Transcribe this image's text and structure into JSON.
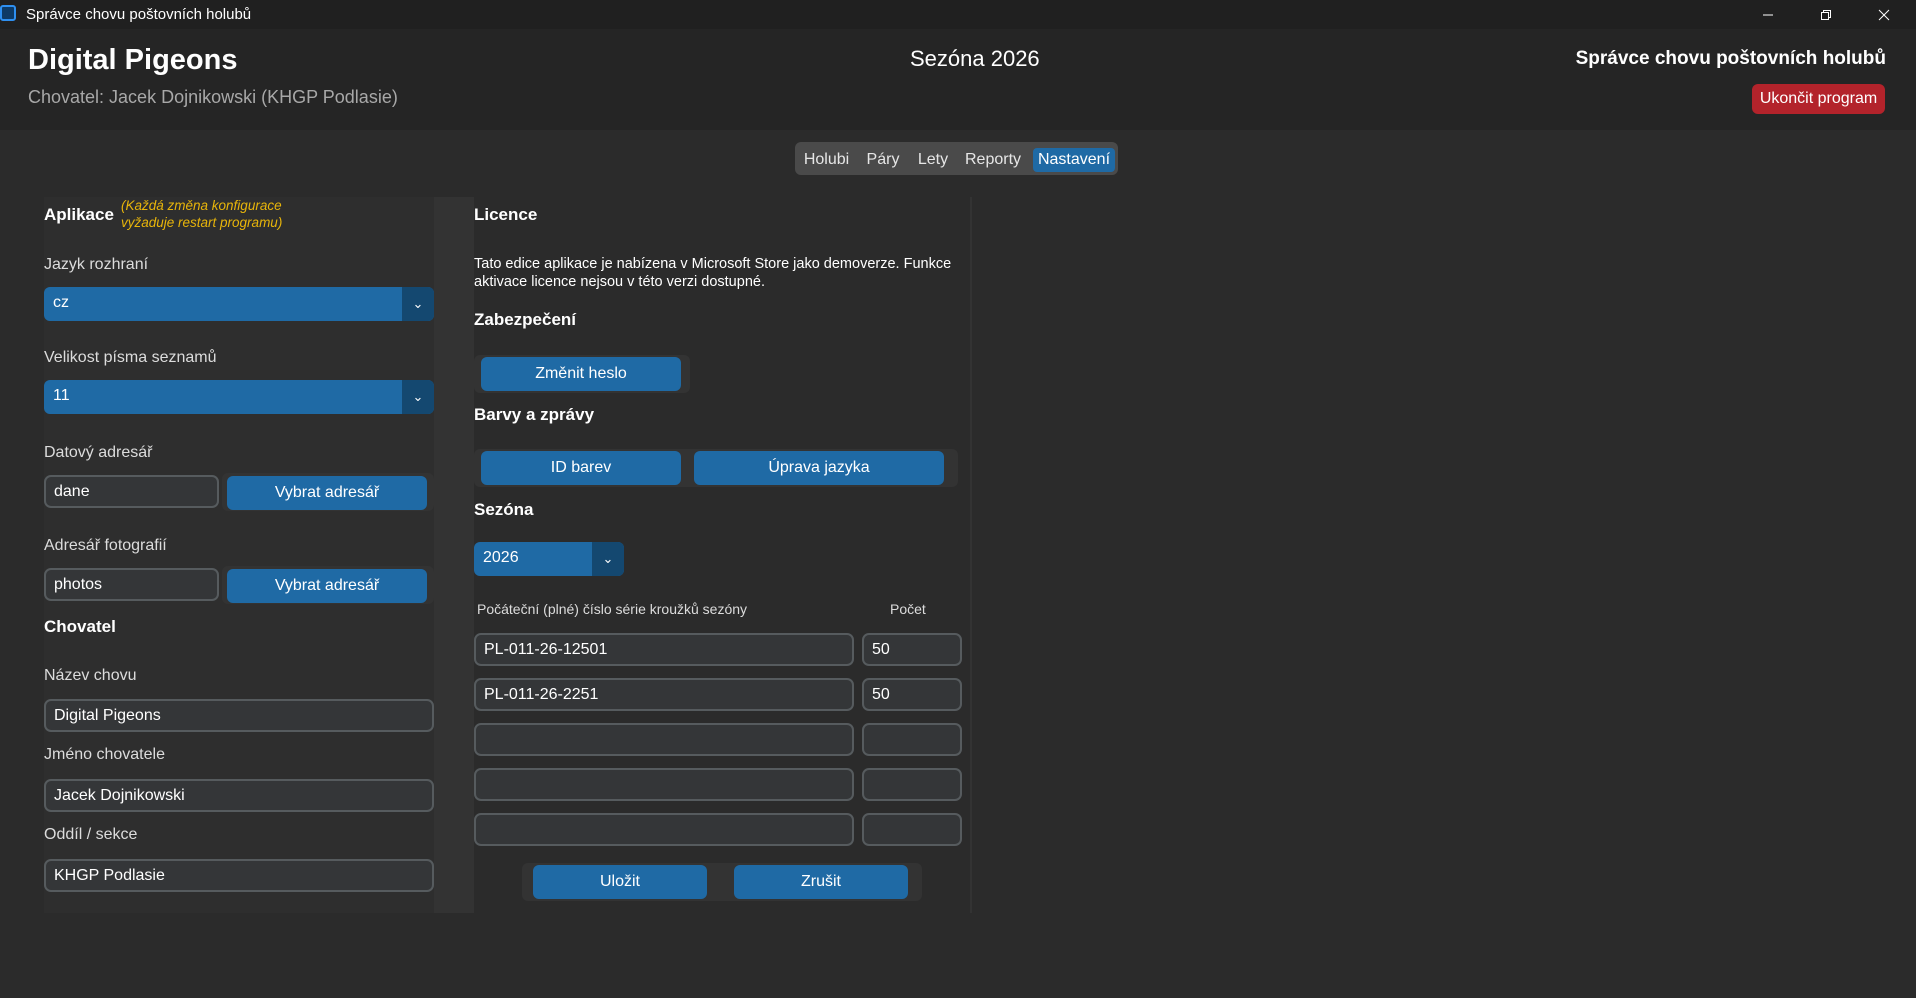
{
  "window": {
    "title": "Správce chovu poštovních holubů"
  },
  "header": {
    "app_name": "Digital Pigeons",
    "breeder_line": "Chovatel: Jacek Dojnikowski (KHGP Podlasie)",
    "season_title": "Sezóna 2026",
    "right_title": "Správce chovu poštovních holubů",
    "quit_label": "Ukončit program"
  },
  "tabs": [
    {
      "label": "Holubi",
      "active": false
    },
    {
      "label": "Páry",
      "active": false
    },
    {
      "label": "Lety",
      "active": false
    },
    {
      "label": "Reporty",
      "active": false
    },
    {
      "label": "Nastavení",
      "active": true
    }
  ],
  "app_settings": {
    "title": "Aplikace",
    "note_line1": "(Každá změna konfigurace",
    "note_line2": "vyžaduje restart programu)",
    "language_label": "Jazyk rozhraní",
    "language_value": "cz",
    "font_size_label": "Velikost písma seznamů",
    "font_size_value": "11",
    "data_dir_label": "Datový adresář",
    "data_dir_value": "dane",
    "data_dir_button": "Vybrat adresář",
    "photo_dir_label": "Adresář fotografií",
    "photo_dir_value": "photos",
    "photo_dir_button": "Vybrat adresář"
  },
  "breeder": {
    "title": "Chovatel",
    "loft_name_label": "Název chovu",
    "loft_name_value": "Digital Pigeons",
    "breeder_name_label": "Jméno chovatele",
    "breeder_name_value": "Jacek Dojnikowski",
    "section_label": "Oddíl / sekce",
    "section_value": "KHGP Podlasie"
  },
  "license": {
    "title": "Licence",
    "text_line1": "Tato edice aplikace je nabízena v Microsoft Store jako demoverze. Funkce",
    "text_line2": "aktivace licence nejsou v této verzi dostupné."
  },
  "security": {
    "title": "Zabezpečení",
    "change_password_button": "Změnit heslo"
  },
  "colors_messages": {
    "title": "Barvy a zprávy",
    "color_ids_button": "ID barev",
    "edit_language_button": "Úprava jazyka"
  },
  "season": {
    "title": "Sezóna",
    "year_value": "2026",
    "col_series": "Počáteční (plné) číslo série kroužků sezóny",
    "col_count": "Počet",
    "rows": [
      {
        "series": "PL-011-26-12501",
        "count": "50"
      },
      {
        "series": "PL-011-26-2251",
        "count": "50"
      },
      {
        "series": "",
        "count": ""
      },
      {
        "series": "",
        "count": ""
      },
      {
        "series": "",
        "count": ""
      }
    ],
    "save_button": "Uložit",
    "cancel_button": "Zrušit"
  }
}
